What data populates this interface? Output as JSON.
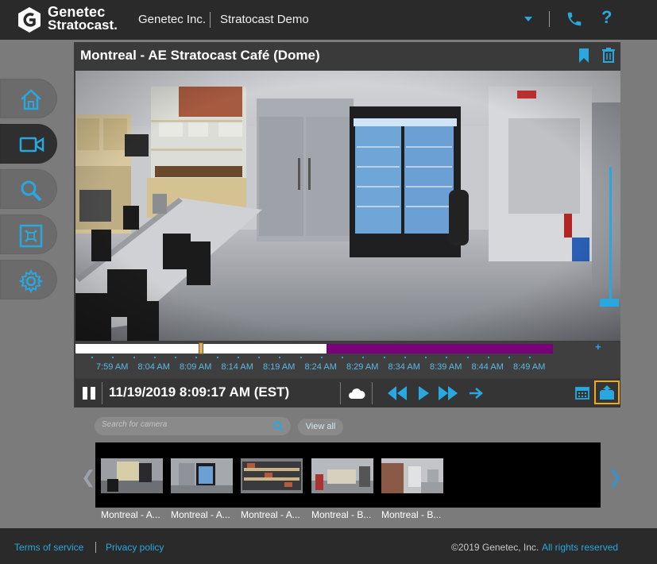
{
  "header": {
    "brand_line1": "Genetec",
    "brand_line2": "Stratocast.",
    "organization": "Genetec Inc.",
    "project": "Stratocast Demo",
    "help_label": "?"
  },
  "nav": {
    "items": [
      "home",
      "cameras",
      "search",
      "settings-view",
      "configuration"
    ],
    "active": "cameras"
  },
  "player": {
    "camera_title": "Montreal - AE Stratocast Café (Dome)",
    "datetime": "11/19/2019 8:09:17 AM (EST)",
    "timeline_plus": "+",
    "timeline_labels": [
      "7:59 AM",
      "8:04 AM",
      "8:09 AM",
      "8:14 AM",
      "8:19 AM",
      "8:24 AM",
      "8:29 AM",
      "8:34 AM",
      "8:39 AM",
      "8:44 AM",
      "8:49 AM"
    ],
    "playback_position_percent": 23,
    "volume_level_percent": 100
  },
  "search": {
    "placeholder": "Search for camera",
    "view_all_label": "View all"
  },
  "thumbnails": [
    {
      "caption": "Montreal - A..."
    },
    {
      "caption": "Montreal - A..."
    },
    {
      "caption": "Montreal - A..."
    },
    {
      "caption": "Montreal - B..."
    },
    {
      "caption": "Montreal - B..."
    }
  ],
  "footer": {
    "terms": "Terms of service",
    "privacy": "Privacy policy",
    "copyright": "©2019 Genetec, Inc.",
    "rights": "All rights reserved"
  },
  "colors": {
    "accent": "#29a8e0",
    "cloud_timeline": "#7a007a",
    "highlight": "#f0a81c",
    "topbar": "#2a2a2a"
  }
}
